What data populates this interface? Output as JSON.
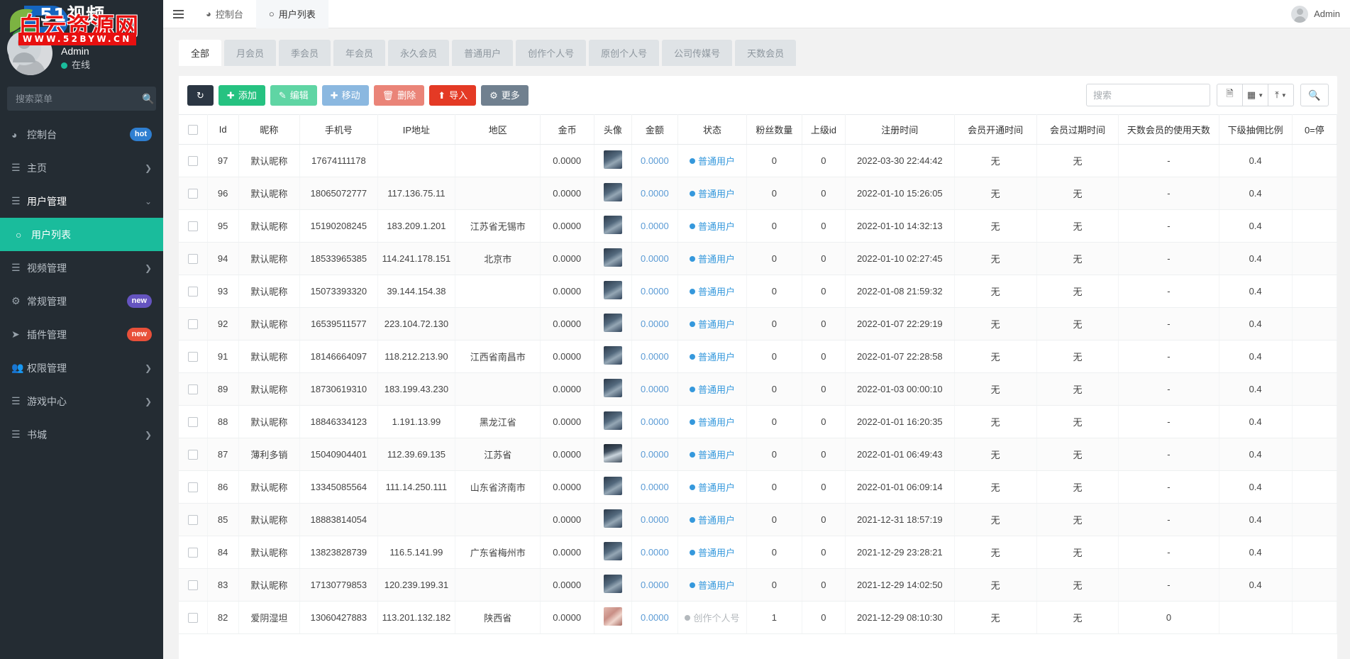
{
  "watermark": {
    "title": "51视频",
    "red_text": "白云资源网",
    "url": "WWW.52BYW.CN"
  },
  "sidebar": {
    "profile": {
      "name": "Admin",
      "status": "在线"
    },
    "search": {
      "placeholder": "搜索菜单",
      "value": "",
      "icon": "search-icon"
    },
    "items": [
      {
        "label": "控制台",
        "icon": "dashboard-icon",
        "badge": "hot",
        "badge_type": "hot",
        "chevron": false,
        "active": false,
        "sub": false
      },
      {
        "label": "主页",
        "icon": "list-icon",
        "badge": "",
        "badge_type": "",
        "chevron": true,
        "active": false,
        "sub": false
      },
      {
        "label": "用户管理",
        "icon": "list-icon",
        "badge": "",
        "badge_type": "",
        "chevron": true,
        "active": true,
        "sub": false
      },
      {
        "label": "用户列表",
        "icon": "circle-icon",
        "badge": "",
        "badge_type": "",
        "chevron": false,
        "active": false,
        "sub": true
      },
      {
        "label": "视频管理",
        "icon": "list-icon",
        "badge": "",
        "badge_type": "",
        "chevron": true,
        "active": false,
        "sub": false
      },
      {
        "label": "常规管理",
        "icon": "gears-icon",
        "badge": "new",
        "badge_type": "new-p",
        "chevron": false,
        "active": false,
        "sub": false
      },
      {
        "label": "插件管理",
        "icon": "rocket-icon",
        "badge": "new",
        "badge_type": "new-r",
        "chevron": false,
        "active": false,
        "sub": false
      },
      {
        "label": "权限管理",
        "icon": "users-icon",
        "badge": "",
        "badge_type": "",
        "chevron": true,
        "active": false,
        "sub": false
      },
      {
        "label": "游戏中心",
        "icon": "list-icon",
        "badge": "",
        "badge_type": "",
        "chevron": true,
        "active": false,
        "sub": false
      },
      {
        "label": "书城",
        "icon": "list-icon",
        "badge": "",
        "badge_type": "",
        "chevron": true,
        "active": false,
        "sub": false
      }
    ]
  },
  "topbar": {
    "tabs": [
      {
        "label": "控制台",
        "icon": "dashboard-icon",
        "active": false
      },
      {
        "label": "用户列表",
        "icon": "circle-icon",
        "active": true
      }
    ],
    "user_name": "Admin"
  },
  "filter_tabs": [
    {
      "label": "全部",
      "active": true
    },
    {
      "label": "月会员",
      "active": false
    },
    {
      "label": "季会员",
      "active": false
    },
    {
      "label": "年会员",
      "active": false
    },
    {
      "label": "永久会员",
      "active": false
    },
    {
      "label": "普通用户",
      "active": false
    },
    {
      "label": "创作个人号",
      "active": false
    },
    {
      "label": "原创个人号",
      "active": false
    },
    {
      "label": "公司传媒号",
      "active": false
    },
    {
      "label": "天数会员",
      "active": false
    }
  ],
  "toolbar": {
    "refresh_label": "",
    "add_label": "添加",
    "edit_label": "编辑",
    "move_label": "移动",
    "delete_label": "删除",
    "import_label": "导入",
    "more_label": "更多",
    "search_placeholder": "搜索",
    "search_value": ""
  },
  "table": {
    "columns": [
      "",
      "Id",
      "昵称",
      "手机号",
      "IP地址",
      "地区",
      "金币",
      "头像",
      "金额",
      "状态",
      "粉丝数量",
      "上级id",
      "注册时间",
      "会员开通时间",
      "会员过期时间",
      "天数会员的使用天数",
      "下级抽佣比例",
      "0=停"
    ],
    "rows": [
      {
        "id": "97",
        "nick": "默认昵称",
        "phone": "17674111178",
        "ip": "",
        "region": "",
        "coin": "0.0000",
        "avatar": "thumb",
        "amount": "0.0000",
        "status": "普通用户",
        "status_type": "normal",
        "fans": "0",
        "parent_id": "0",
        "reg_time": "2022-03-30 22:44:42",
        "vip_open": "无",
        "vip_exp": "无",
        "days_used": "-",
        "commission": "0.4",
        "extra": ""
      },
      {
        "id": "96",
        "nick": "默认昵称",
        "phone": "18065072777",
        "ip": "117.136.75.11",
        "region": "",
        "coin": "0.0000",
        "avatar": "thumb",
        "amount": "0.0000",
        "status": "普通用户",
        "status_type": "normal",
        "fans": "0",
        "parent_id": "0",
        "reg_time": "2022-01-10 15:26:05",
        "vip_open": "无",
        "vip_exp": "无",
        "days_used": "-",
        "commission": "0.4",
        "extra": ""
      },
      {
        "id": "95",
        "nick": "默认昵称",
        "phone": "15190208245",
        "ip": "183.209.1.201",
        "region": "江苏省无锡市",
        "coin": "0.0000",
        "avatar": "thumb",
        "amount": "0.0000",
        "status": "普通用户",
        "status_type": "normal",
        "fans": "0",
        "parent_id": "0",
        "reg_time": "2022-01-10 14:32:13",
        "vip_open": "无",
        "vip_exp": "无",
        "days_used": "-",
        "commission": "0.4",
        "extra": ""
      },
      {
        "id": "94",
        "nick": "默认昵称",
        "phone": "18533965385",
        "ip": "114.241.178.151",
        "region": "北京市",
        "coin": "0.0000",
        "avatar": "thumb",
        "amount": "0.0000",
        "status": "普通用户",
        "status_type": "normal",
        "fans": "0",
        "parent_id": "0",
        "reg_time": "2022-01-10 02:27:45",
        "vip_open": "无",
        "vip_exp": "无",
        "days_used": "-",
        "commission": "0.4",
        "extra": ""
      },
      {
        "id": "93",
        "nick": "默认昵称",
        "phone": "15073393320",
        "ip": "39.144.154.38",
        "region": "",
        "coin": "0.0000",
        "avatar": "thumb",
        "amount": "0.0000",
        "status": "普通用户",
        "status_type": "normal",
        "fans": "0",
        "parent_id": "0",
        "reg_time": "2022-01-08 21:59:32",
        "vip_open": "无",
        "vip_exp": "无",
        "days_used": "-",
        "commission": "0.4",
        "extra": ""
      },
      {
        "id": "92",
        "nick": "默认昵称",
        "phone": "16539511577",
        "ip": "223.104.72.130",
        "region": "",
        "coin": "0.0000",
        "avatar": "thumb",
        "amount": "0.0000",
        "status": "普通用户",
        "status_type": "normal",
        "fans": "0",
        "parent_id": "0",
        "reg_time": "2022-01-07 22:29:19",
        "vip_open": "无",
        "vip_exp": "无",
        "days_used": "-",
        "commission": "0.4",
        "extra": ""
      },
      {
        "id": "91",
        "nick": "默认昵称",
        "phone": "18146664097",
        "ip": "118.212.213.90",
        "region": "江西省南昌市",
        "coin": "0.0000",
        "avatar": "thumb",
        "amount": "0.0000",
        "status": "普通用户",
        "status_type": "normal",
        "fans": "0",
        "parent_id": "0",
        "reg_time": "2022-01-07 22:28:58",
        "vip_open": "无",
        "vip_exp": "无",
        "days_used": "-",
        "commission": "0.4",
        "extra": ""
      },
      {
        "id": "89",
        "nick": "默认昵称",
        "phone": "18730619310",
        "ip": "183.199.43.230",
        "region": "",
        "coin": "0.0000",
        "avatar": "thumb",
        "amount": "0.0000",
        "status": "普通用户",
        "status_type": "normal",
        "fans": "0",
        "parent_id": "0",
        "reg_time": "2022-01-03 00:00:10",
        "vip_open": "无",
        "vip_exp": "无",
        "days_used": "-",
        "commission": "0.4",
        "extra": ""
      },
      {
        "id": "88",
        "nick": "默认昵称",
        "phone": "18846334123",
        "ip": "1.191.13.99",
        "region": "黑龙江省",
        "coin": "0.0000",
        "avatar": "thumb",
        "amount": "0.0000",
        "status": "普通用户",
        "status_type": "normal",
        "fans": "0",
        "parent_id": "0",
        "reg_time": "2022-01-01 16:20:35",
        "vip_open": "无",
        "vip_exp": "无",
        "days_used": "-",
        "commission": "0.4",
        "extra": ""
      },
      {
        "id": "87",
        "nick": "薄利多销",
        "phone": "15040904401",
        "ip": "112.39.69.135",
        "region": "江苏省",
        "coin": "0.0000",
        "avatar": "thumb-alt1",
        "amount": "0.0000",
        "status": "普通用户",
        "status_type": "normal",
        "fans": "0",
        "parent_id": "0",
        "reg_time": "2022-01-01 06:49:43",
        "vip_open": "无",
        "vip_exp": "无",
        "days_used": "-",
        "commission": "0.4",
        "extra": ""
      },
      {
        "id": "86",
        "nick": "默认昵称",
        "phone": "13345085564",
        "ip": "111.14.250.111",
        "region": "山东省济南市",
        "coin": "0.0000",
        "avatar": "thumb",
        "amount": "0.0000",
        "status": "普通用户",
        "status_type": "normal",
        "fans": "0",
        "parent_id": "0",
        "reg_time": "2022-01-01 06:09:14",
        "vip_open": "无",
        "vip_exp": "无",
        "days_used": "-",
        "commission": "0.4",
        "extra": ""
      },
      {
        "id": "85",
        "nick": "默认昵称",
        "phone": "18883814054",
        "ip": "",
        "region": "",
        "coin": "0.0000",
        "avatar": "thumb",
        "amount": "0.0000",
        "status": "普通用户",
        "status_type": "normal",
        "fans": "0",
        "parent_id": "0",
        "reg_time": "2021-12-31 18:57:19",
        "vip_open": "无",
        "vip_exp": "无",
        "days_used": "-",
        "commission": "0.4",
        "extra": ""
      },
      {
        "id": "84",
        "nick": "默认昵称",
        "phone": "13823828739",
        "ip": "116.5.141.99",
        "region": "广东省梅州市",
        "coin": "0.0000",
        "avatar": "thumb",
        "amount": "0.0000",
        "status": "普通用户",
        "status_type": "normal",
        "fans": "0",
        "parent_id": "0",
        "reg_time": "2021-12-29 23:28:21",
        "vip_open": "无",
        "vip_exp": "无",
        "days_used": "-",
        "commission": "0.4",
        "extra": ""
      },
      {
        "id": "83",
        "nick": "默认昵称",
        "phone": "17130779853",
        "ip": "120.239.199.31",
        "region": "",
        "coin": "0.0000",
        "avatar": "thumb",
        "amount": "0.0000",
        "status": "普通用户",
        "status_type": "normal",
        "fans": "0",
        "parent_id": "0",
        "reg_time": "2021-12-29 14:02:50",
        "vip_open": "无",
        "vip_exp": "无",
        "days_used": "-",
        "commission": "0.4",
        "extra": ""
      },
      {
        "id": "82",
        "nick": "爱阴湿坦",
        "phone": "13060427883",
        "ip": "113.201.132.182",
        "region": "陕西省",
        "coin": "0.0000",
        "avatar": "thumb-alt2",
        "amount": "0.0000",
        "status": "创作个人号",
        "status_type": "gray",
        "fans": "1",
        "parent_id": "0",
        "reg_time": "2021-12-29 08:10:30",
        "vip_open": "无",
        "vip_exp": "无",
        "days_used": "0",
        "commission": "",
        "extra": ""
      }
    ]
  }
}
